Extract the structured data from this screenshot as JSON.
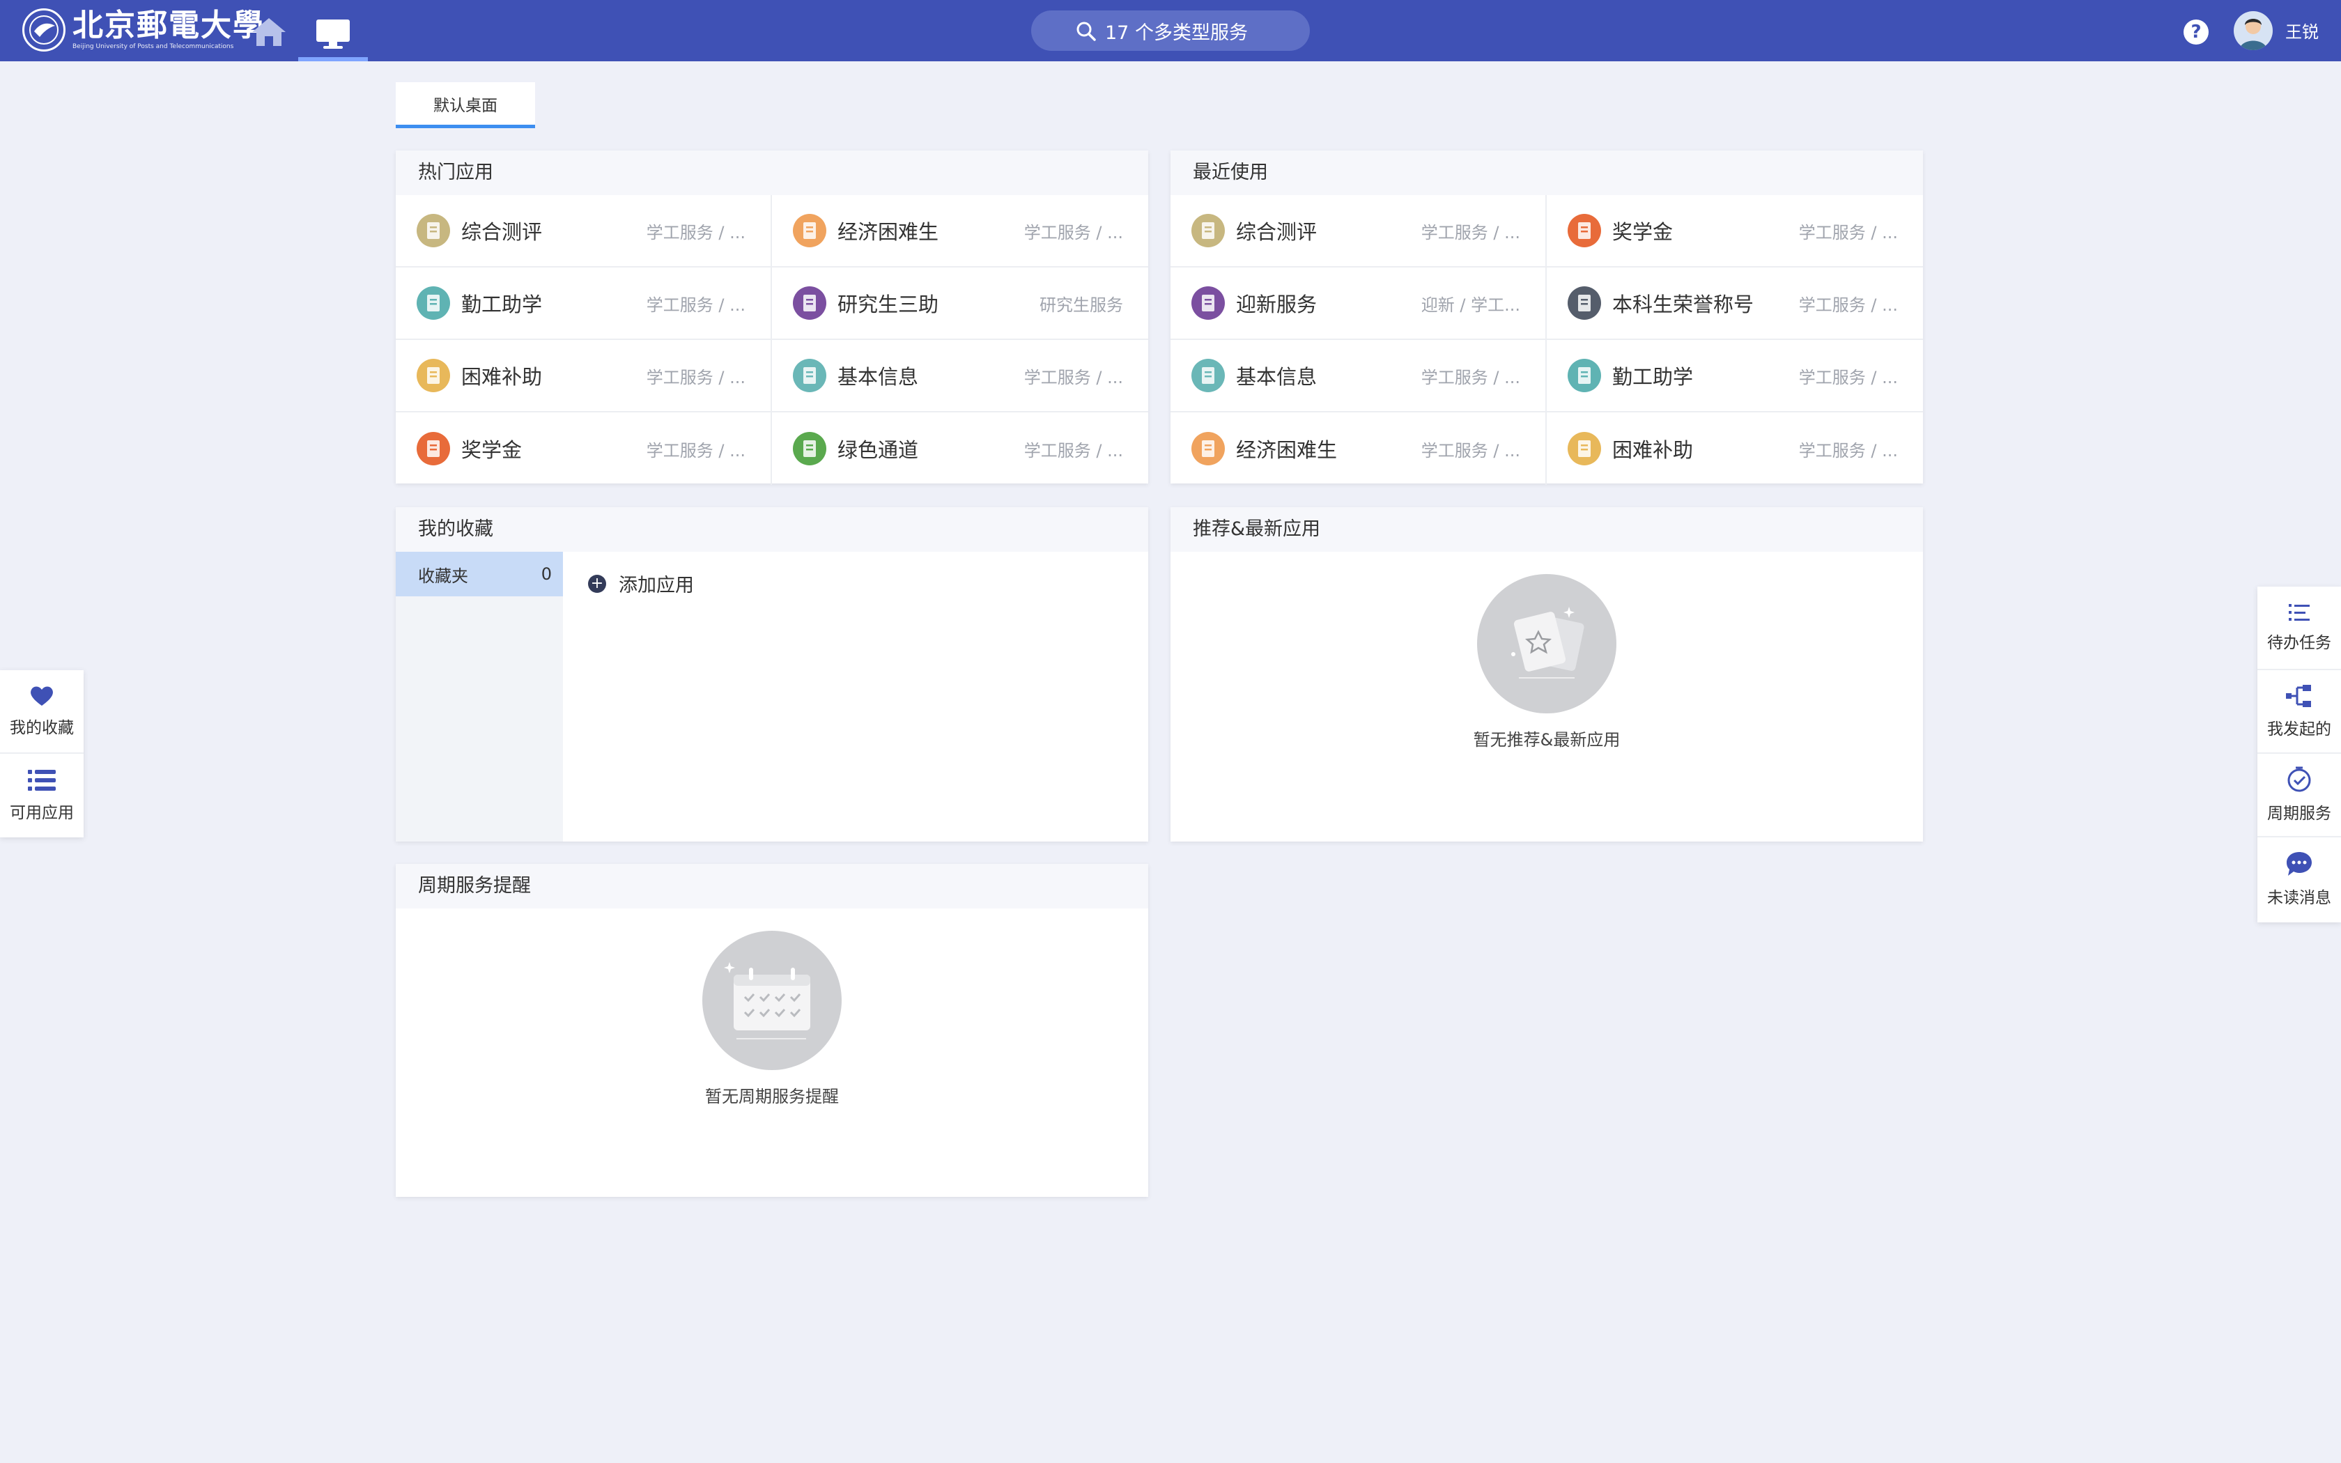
{
  "header": {
    "logo_cn": "北京郵電大學",
    "logo_en": "Beijing University of Posts and Telecommunications",
    "search_label": "17 个多类型服务",
    "help_label": "?",
    "username": "王锐",
    "colors": {
      "bar": "#3f51b5",
      "search": "#5e6fc6",
      "active": "#7fa4ff"
    },
    "icons": [
      "home-icon",
      "desktop-icon",
      "search-icon",
      "help-icon"
    ]
  },
  "tab": {
    "label": "默认桌面"
  },
  "hot_apps": {
    "title": "热门应用",
    "items": [
      {
        "name": "综合测评",
        "category": "学工服务 / ...",
        "icon": "evaluation-icon",
        "color": "#c7b780"
      },
      {
        "name": "经济困难生",
        "category": "学工服务 / ...",
        "icon": "hardship-icon",
        "color": "#f0a35e"
      },
      {
        "name": "勤工助学",
        "category": "学工服务 / ...",
        "icon": "hourglass-icon",
        "color": "#5fb3b3"
      },
      {
        "name": "研究生三助",
        "category": "研究生服务",
        "icon": "graduate-icon",
        "color": "#7b4fa0"
      },
      {
        "name": "困难补助",
        "category": "学工服务 / ...",
        "icon": "subsidy-icon",
        "color": "#e8b85a"
      },
      {
        "name": "基本信息",
        "category": "学工服务 / ...",
        "icon": "info-icon",
        "color": "#6ab7b7"
      },
      {
        "name": "奖学金",
        "category": "学工服务 / ...",
        "icon": "scholarship-icon",
        "color": "#e86b3a"
      },
      {
        "name": "绿色通道",
        "category": "学工服务 / ...",
        "icon": "green-channel-icon",
        "color": "#5aa94e"
      }
    ]
  },
  "recent_apps": {
    "title": "最近使用",
    "items": [
      {
        "name": "综合测评",
        "category": "学工服务 / ...",
        "icon": "evaluation-icon",
        "color": "#c7b780"
      },
      {
        "name": "奖学金",
        "category": "学工服务 / ...",
        "icon": "scholarship-icon",
        "color": "#e86b3a"
      },
      {
        "name": "迎新服务",
        "category": "迎新 / 学工...",
        "icon": "welcome-icon",
        "color": "#7b4fa0"
      },
      {
        "name": "本科生荣誉称号",
        "category": "学工服务 / ...",
        "icon": "honor-icon",
        "color": "#555d6b"
      },
      {
        "name": "基本信息",
        "category": "学工服务 / ...",
        "icon": "info-icon",
        "color": "#6ab7b7"
      },
      {
        "name": "勤工助学",
        "category": "学工服务 / ...",
        "icon": "hourglass-icon",
        "color": "#5fb3b3"
      },
      {
        "name": "经济困难生",
        "category": "学工服务 / ...",
        "icon": "hardship-icon",
        "color": "#f0a35e"
      },
      {
        "name": "困难补助",
        "category": "学工服务 / ...",
        "icon": "subsidy-icon",
        "color": "#e8b85a"
      }
    ]
  },
  "favorites": {
    "title": "我的收藏",
    "folder_label": "收藏夹",
    "folder_count": "0",
    "add_label": "添加应用"
  },
  "recommend": {
    "title": "推荐&最新应用",
    "empty_text": "暂无推荐&最新应用"
  },
  "periodic": {
    "title": "周期服务提醒",
    "empty_text": "暂无周期服务提醒"
  },
  "side_left": [
    {
      "label": "我的收藏",
      "icon": "heart-icon"
    },
    {
      "label": "可用应用",
      "icon": "list-icon"
    }
  ],
  "side_right": [
    {
      "label": "待办任务",
      "icon": "todo-icon"
    },
    {
      "label": "我发起的",
      "icon": "flow-icon"
    },
    {
      "label": "周期服务",
      "icon": "check-circle-icon"
    },
    {
      "label": "未读消息",
      "icon": "chat-icon"
    }
  ]
}
